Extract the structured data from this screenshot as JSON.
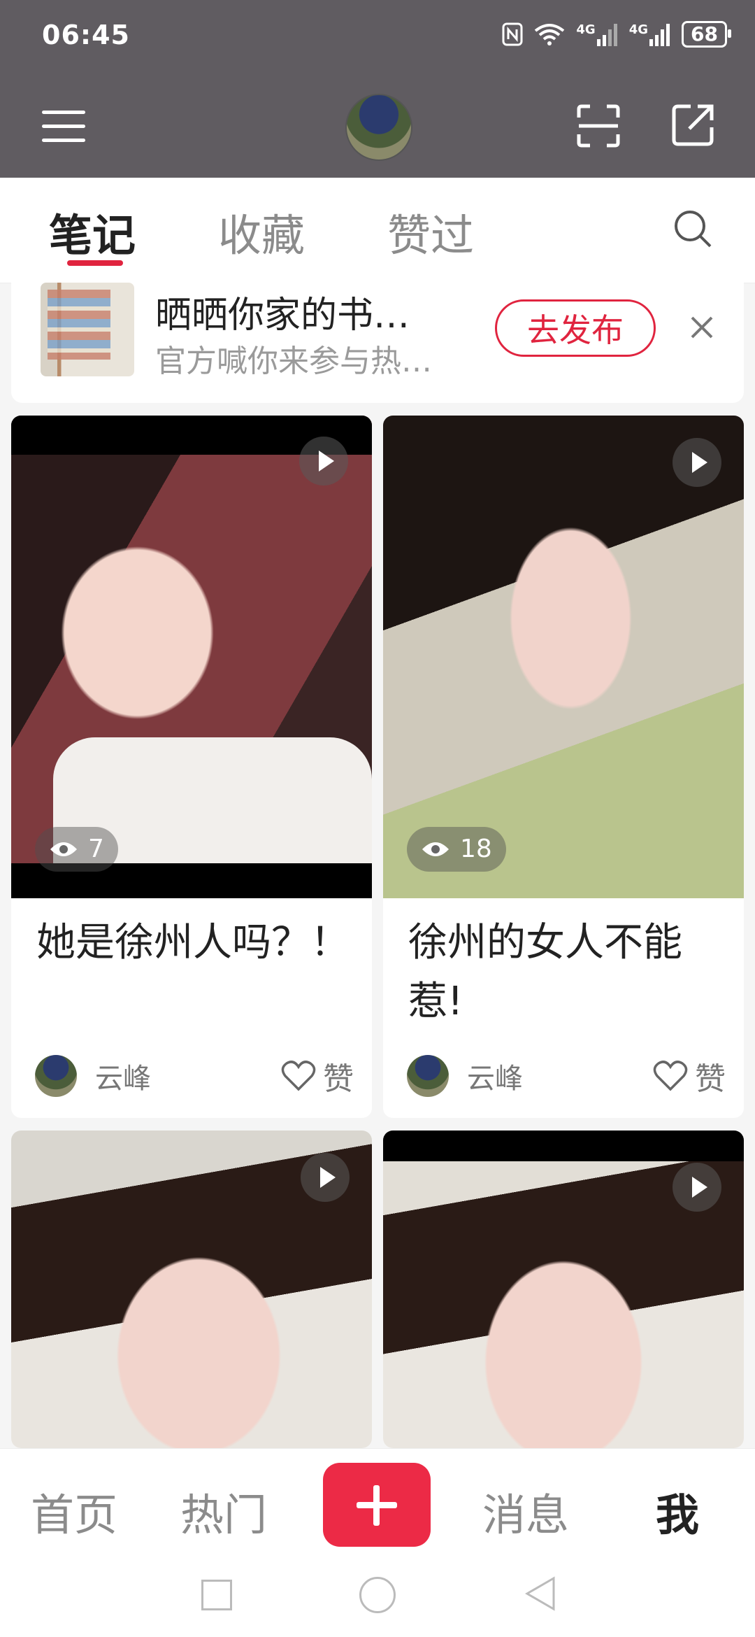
{
  "status_bar": {
    "time": "06:45",
    "battery": "68",
    "network_1": "4G",
    "network_2": "4G"
  },
  "tabs": [
    {
      "label": "笔记",
      "active": true
    },
    {
      "label": "收藏",
      "active": false
    },
    {
      "label": "赞过",
      "active": false
    }
  ],
  "promo": {
    "title": "晒晒你家的书…",
    "subtitle": "官方喊你来参与热…",
    "button": "去发布"
  },
  "cards": [
    {
      "title": "她是徐州人吗？！",
      "views": "7",
      "author": "云峰",
      "like_label": "赞"
    },
    {
      "title": "徐州的女人不能惹!",
      "views": "18",
      "author": "云峰",
      "like_label": "赞"
    },
    {
      "title": "",
      "views": "",
      "author": "",
      "like_label": ""
    },
    {
      "title": "",
      "views": "",
      "author": "",
      "like_label": ""
    }
  ],
  "bottom_nav": [
    {
      "label": "首页",
      "active": false
    },
    {
      "label": "热门",
      "active": false
    },
    {
      "label": "消息",
      "active": false
    },
    {
      "label": "我",
      "active": true
    }
  ],
  "colors": {
    "accent": "#e0243f",
    "header_bg": "#605c61",
    "page_bg": "#f5f5f5"
  }
}
